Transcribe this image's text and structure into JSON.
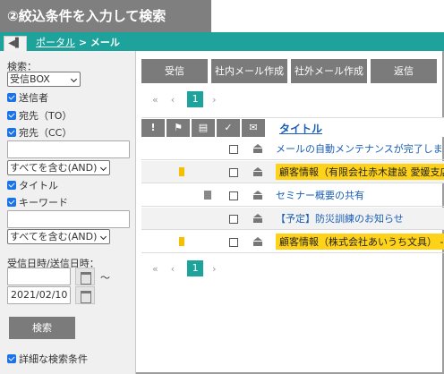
{
  "caption": "②絞込条件を入力して検索",
  "breadcrumb": {
    "portal": "ポータル",
    "sep": ">",
    "current": "メール"
  },
  "sidebar": {
    "search_label": "検索：",
    "folder_select": "受信BOX",
    "checks": [
      "送信者",
      "宛先（TO）",
      "宛先（CC）"
    ],
    "match_select_1": "すべてを含む(AND)",
    "checks2": [
      "タイトル",
      "キーワード"
    ],
    "match_select_2": "すべてを含む(AND)",
    "date_label": "受信日時/送信日時：",
    "date_from": "",
    "date_tilde": "～",
    "date_to": "2021/02/10",
    "search_button": "検索",
    "advanced_label": "詳細な検索条件"
  },
  "toolbar": [
    "受信",
    "社内メール作成",
    "社外メール作成",
    "返信"
  ],
  "pager": {
    "first": "«",
    "prev": "‹",
    "page": "1",
    "next": "›"
  },
  "table": {
    "headers": [
      "!",
      "flag-icon",
      "memo-icon",
      "✓",
      "envelope-icon"
    ],
    "title_header": "タイトル",
    "rows": [
      {
        "subject": "メールの自動メンテナンスが完了しました",
        "flag": false,
        "memo": false,
        "highlight": false
      },
      {
        "subject": "顧客情報（有限会社赤木建設 愛媛支店）",
        "flag": true,
        "memo": false,
        "highlight": true
      },
      {
        "subject": "セミナー概要の共有",
        "flag": false,
        "memo": true,
        "highlight": false
      },
      {
        "subject": "【予定】防災訓練のお知らせ",
        "flag": false,
        "memo": false,
        "highlight": false
      },
      {
        "subject": "顧客情報（株式会社あいうち文具） - S",
        "flag": true,
        "memo": false,
        "highlight": true
      }
    ]
  },
  "colors": {
    "accent": "#1ea39c",
    "button": "#7b7b7b",
    "highlight": "#ffd21a",
    "link": "#1a5fb4"
  }
}
